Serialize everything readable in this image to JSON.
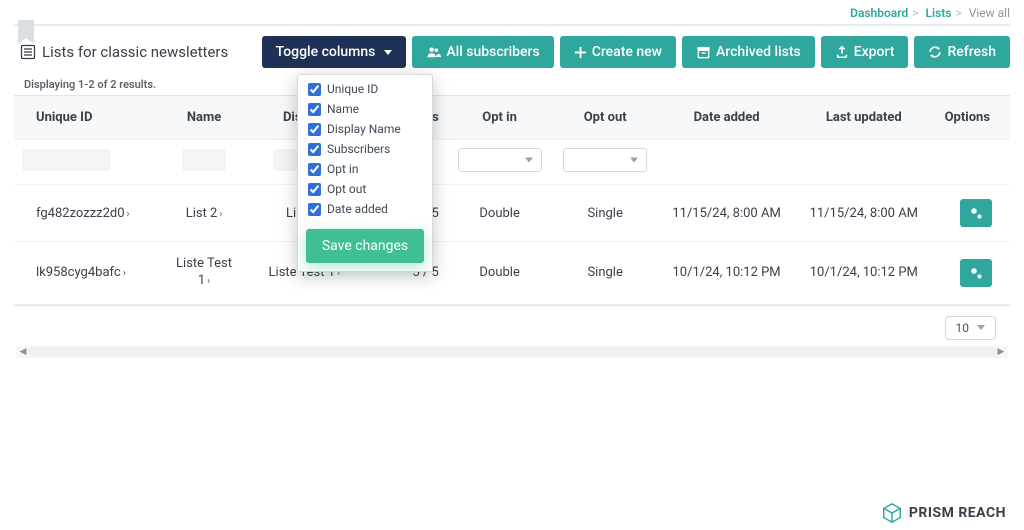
{
  "breadcrumb": {
    "a": "Dashboard",
    "b": "Lists",
    "c": "View all"
  },
  "title": "Lists for classic newsletters",
  "buttons": {
    "toggle": "Toggle columns",
    "subs": "All subscribers",
    "create": "Create new",
    "archived": "Archived lists",
    "export": "Export",
    "refresh": "Refresh"
  },
  "displaying": "Displaying 1-2 of 2 results.",
  "columns": [
    "Unique ID",
    "Name",
    "Display",
    "pers",
    "Opt in",
    "Opt out",
    "Date added",
    "Last updated",
    "Options"
  ],
  "toggle_options": [
    "Unique ID",
    "Name",
    "Display Name",
    "Subscribers",
    "Opt in",
    "Opt out",
    "Date added"
  ],
  "save_label": "Save changes",
  "rows": [
    {
      "uid": "fg482zozzz2d0",
      "name": "List 2",
      "display": "List 2",
      "subscribers": "5 / 5",
      "optin": "Double",
      "optout": "Single",
      "added": "11/15/24, 8:00 AM",
      "updated": "11/15/24, 8:00 AM"
    },
    {
      "uid": "lk958cyg4bafc",
      "name": "Liste Test 1",
      "display": "Liste Test 1",
      "subscribers": "5 / 5",
      "optin": "Double",
      "optout": "Single",
      "added": "10/1/24, 10:12 PM",
      "updated": "10/1/24, 10:12 PM"
    }
  ],
  "page_size": "10",
  "brand": "PRISM REACH",
  "colors": {
    "teal": "#2fa79c",
    "navy": "#1f3155"
  }
}
